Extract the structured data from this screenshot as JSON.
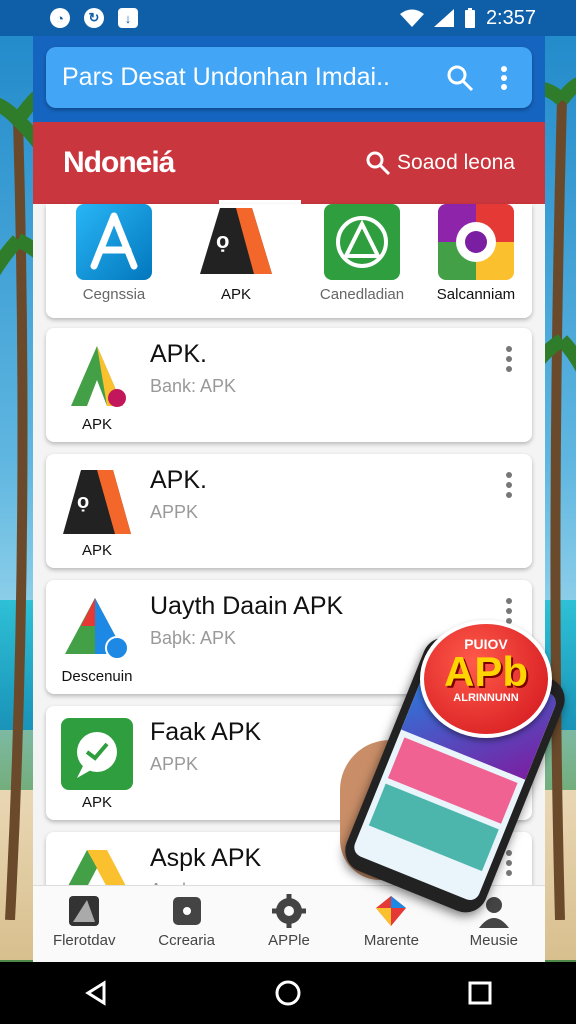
{
  "status_bar": {
    "left_icons": [
      "app-notification-icon",
      "refresh-icon",
      "download-icon"
    ],
    "time": "2:357"
  },
  "search_bar": {
    "title": "Pars Desat Undonhan Imdai..",
    "search_icon": "search-icon",
    "menu_icon": "more-vertical-icon"
  },
  "header": {
    "brand": "Ndoneiá",
    "search_label": "Soaod leona"
  },
  "featured": [
    {
      "label": "Cegnssia",
      "icon": "app-store-icon"
    },
    {
      "label": "APK",
      "icon": "apk-icon"
    },
    {
      "label": "Canedladian",
      "icon": "triangle-app-icon"
    },
    {
      "label": "Salcanniam",
      "icon": "camera-app-icon"
    }
  ],
  "apps": [
    {
      "name": "APK.",
      "meta": "Bank: APK",
      "sub": "APK",
      "icon": "a-logo-icon"
    },
    {
      "name": "APK.",
      "meta": "APPK",
      "sub": "APK",
      "icon": "apk-icon"
    },
    {
      "name": "Uayth Daain APK",
      "meta": "Baþk: APK",
      "sub": "Descenuin",
      "icon": "colorful-a-icon"
    },
    {
      "name": "Faak APK",
      "meta": "APPK",
      "sub": "APK",
      "icon": "chat-bubble-icon"
    },
    {
      "name": "Aspk APK",
      "meta": "Apply",
      "sub": "",
      "icon": "drive-icon"
    }
  ],
  "promo": {
    "top": "PUIOV",
    "main": "APb",
    "bottom": "ALRINNUNN"
  },
  "bottom_nav": [
    {
      "label": "Flerotdav",
      "icon": "flerotdav-icon"
    },
    {
      "label": "Ccrearia",
      "icon": "crearia-icon"
    },
    {
      "label": "APPle",
      "icon": "gear-icon"
    },
    {
      "label": "Marente",
      "icon": "shield-icon"
    },
    {
      "label": "Meusie",
      "icon": "user-icon"
    }
  ],
  "colors": {
    "primary": "#1565c0",
    "search_bg": "#42a5f5",
    "header_red": "#c9363e"
  }
}
